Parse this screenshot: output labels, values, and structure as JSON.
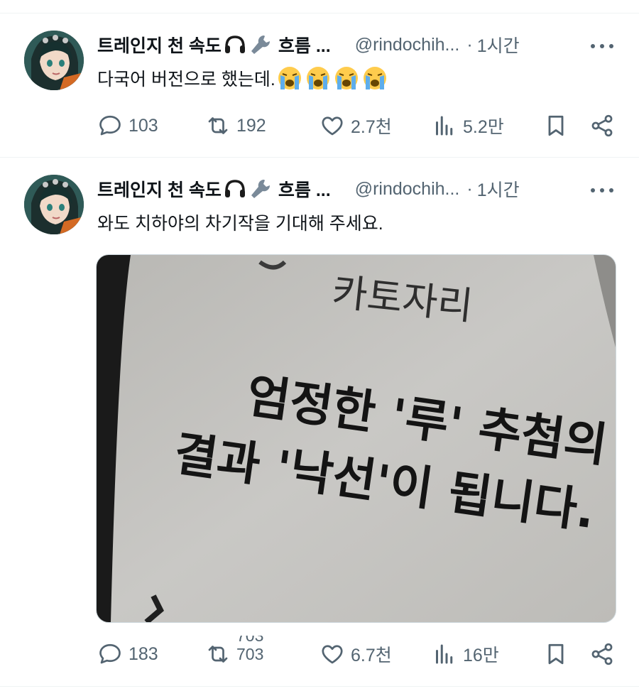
{
  "colors": {
    "text": "#0f1419",
    "muted": "#536471",
    "divider": "#eff3f4",
    "border": "#cfd9de"
  },
  "tweets": [
    {
      "author_name": "트레인지 천 속도",
      "author_name_icons": [
        "headphones-icon",
        "wrench-icon"
      ],
      "author_name_suffix": "흐름 ...",
      "handle": "@rindochih...",
      "dot": "·",
      "time": "1시간",
      "text": "다국어 버전으로 했는데.",
      "emojis": [
        "loudly-crying-face-emoji",
        "loudly-crying-face-emoji",
        "loudly-crying-face-emoji",
        "loudly-crying-face-emoji"
      ],
      "metrics": {
        "replies": "103",
        "reposts": "192",
        "likes": "2.7천",
        "views": "5.2만"
      }
    },
    {
      "author_name": "트레인지 천 속도",
      "author_name_icons": [
        "headphones-icon",
        "wrench-icon"
      ],
      "author_name_suffix": "흐름 ...",
      "handle": "@rindochih...",
      "dot": "·",
      "time": "1시간",
      "text": "와도 치하야의 차기작을 기대해 주세요.",
      "media": {
        "kind": "photo",
        "photo_text_top": "카토자리",
        "photo_text_lines": [
          "엄정한 '루' 추첨의",
          "결과 '낙선'이 됩니다."
        ]
      },
      "metrics": {
        "replies": "183",
        "reposts_rolling": [
          "703",
          "703"
        ],
        "likes": "6.7천",
        "views": "16만"
      }
    }
  ]
}
